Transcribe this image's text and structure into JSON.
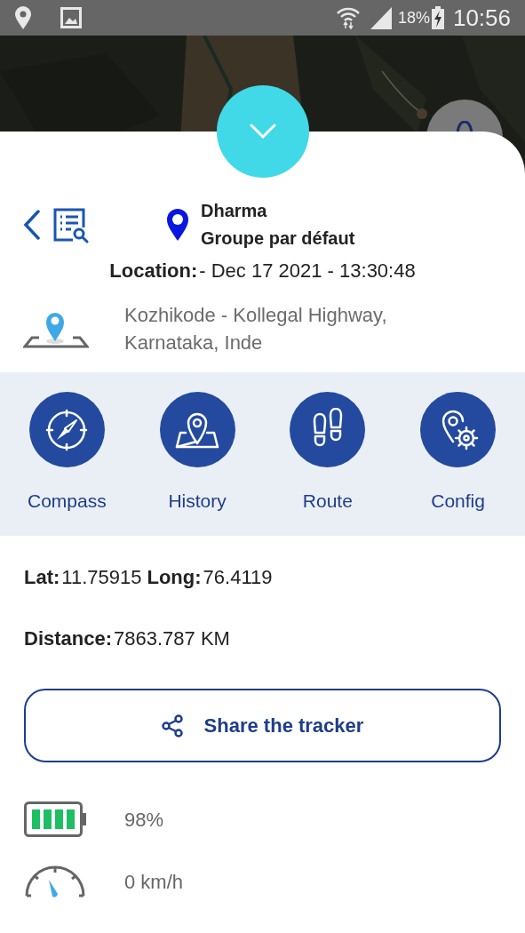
{
  "status_bar": {
    "battery": "18%",
    "time": "10:56"
  },
  "sheet": {
    "device": {
      "name": "Dharma",
      "group": "Groupe par défaut"
    },
    "location": {
      "label": "Location:",
      "value": "- Dec 17 2021 - 13:30:48"
    },
    "address": "Kozhikode - Kollegal Highway, Karnataka, Inde",
    "actions": [
      {
        "kind": "compass",
        "label": "Compass"
      },
      {
        "kind": "history",
        "label": "History"
      },
      {
        "kind": "route",
        "label": "Route"
      },
      {
        "kind": "config",
        "label": "Config"
      }
    ],
    "coords": {
      "lat_label": "Lat:",
      "lat": "11.75915",
      "long_label": "Long:",
      "long": "76.4119"
    },
    "distance": {
      "label": "Distance:",
      "value": "7863.787 KM"
    },
    "share_button": "Share the tracker",
    "battery": "98%",
    "speed": "0 km/h"
  }
}
